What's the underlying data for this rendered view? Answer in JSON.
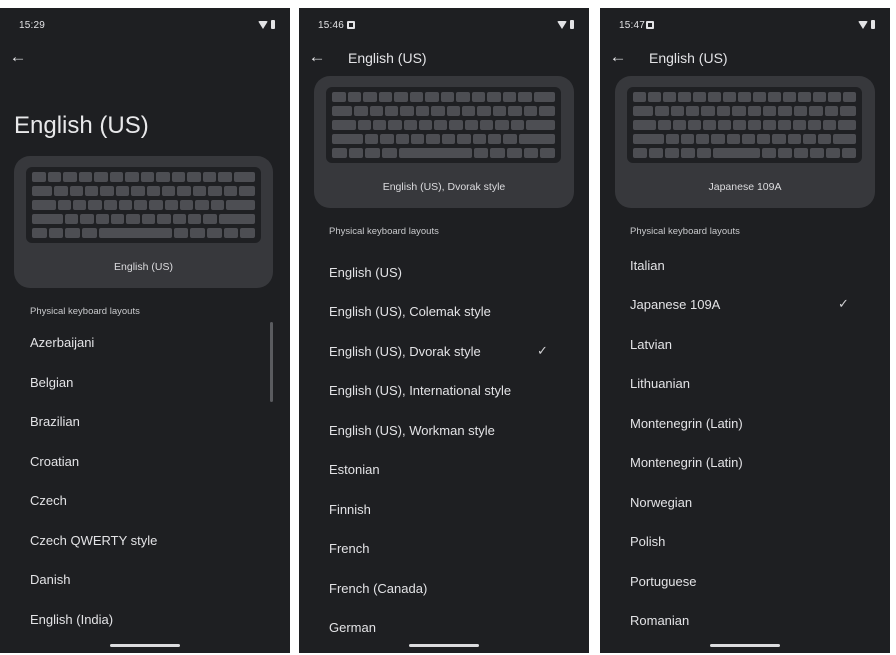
{
  "screens": [
    {
      "status_time": "15:29",
      "title": "English (US)",
      "preview_caption": "English (US)",
      "section_header": "Physical keyboard layouts",
      "items": [
        "Azerbaijani",
        "Belgian",
        "Brazilian",
        "Croatian",
        "Czech",
        "Czech QWERTY style",
        "Danish",
        "English (India)"
      ],
      "selected_item": ""
    },
    {
      "status_time": "15:46",
      "title": "English (US)",
      "preview_caption": "English (US), Dvorak style",
      "section_header": "Physical keyboard layouts",
      "items": [
        "English (US)",
        "English (US), Colemak style",
        "English (US), Dvorak style",
        "English (US), International style",
        "English (US), Workman style",
        "Estonian",
        "Finnish",
        "French",
        "French (Canada)",
        "German"
      ],
      "selected_item": "English (US), Dvorak style"
    },
    {
      "status_time": "15:47",
      "title": "English (US)",
      "preview_caption": "Japanese 109A",
      "section_header": "Physical keyboard layouts",
      "items": [
        "Italian",
        "Japanese 109A",
        "Latvian",
        "Lithuanian",
        "Montenegrin (Latin)",
        "Montenegrin (Latin)",
        "Norwegian",
        "Polish",
        "Portuguese",
        "Romanian"
      ],
      "selected_item": "Japanese 109A"
    }
  ],
  "icons": {
    "back": "back-arrow-icon",
    "selected": "check-icon",
    "wifi": "wifi-icon",
    "battery": "battery-icon",
    "notification": "notification-icon"
  },
  "colors": {
    "background": "#1e1f22",
    "card": "#37383c",
    "keyboard": "#1f2023",
    "key": "#4d4e53",
    "text": "#e3e3e6"
  }
}
